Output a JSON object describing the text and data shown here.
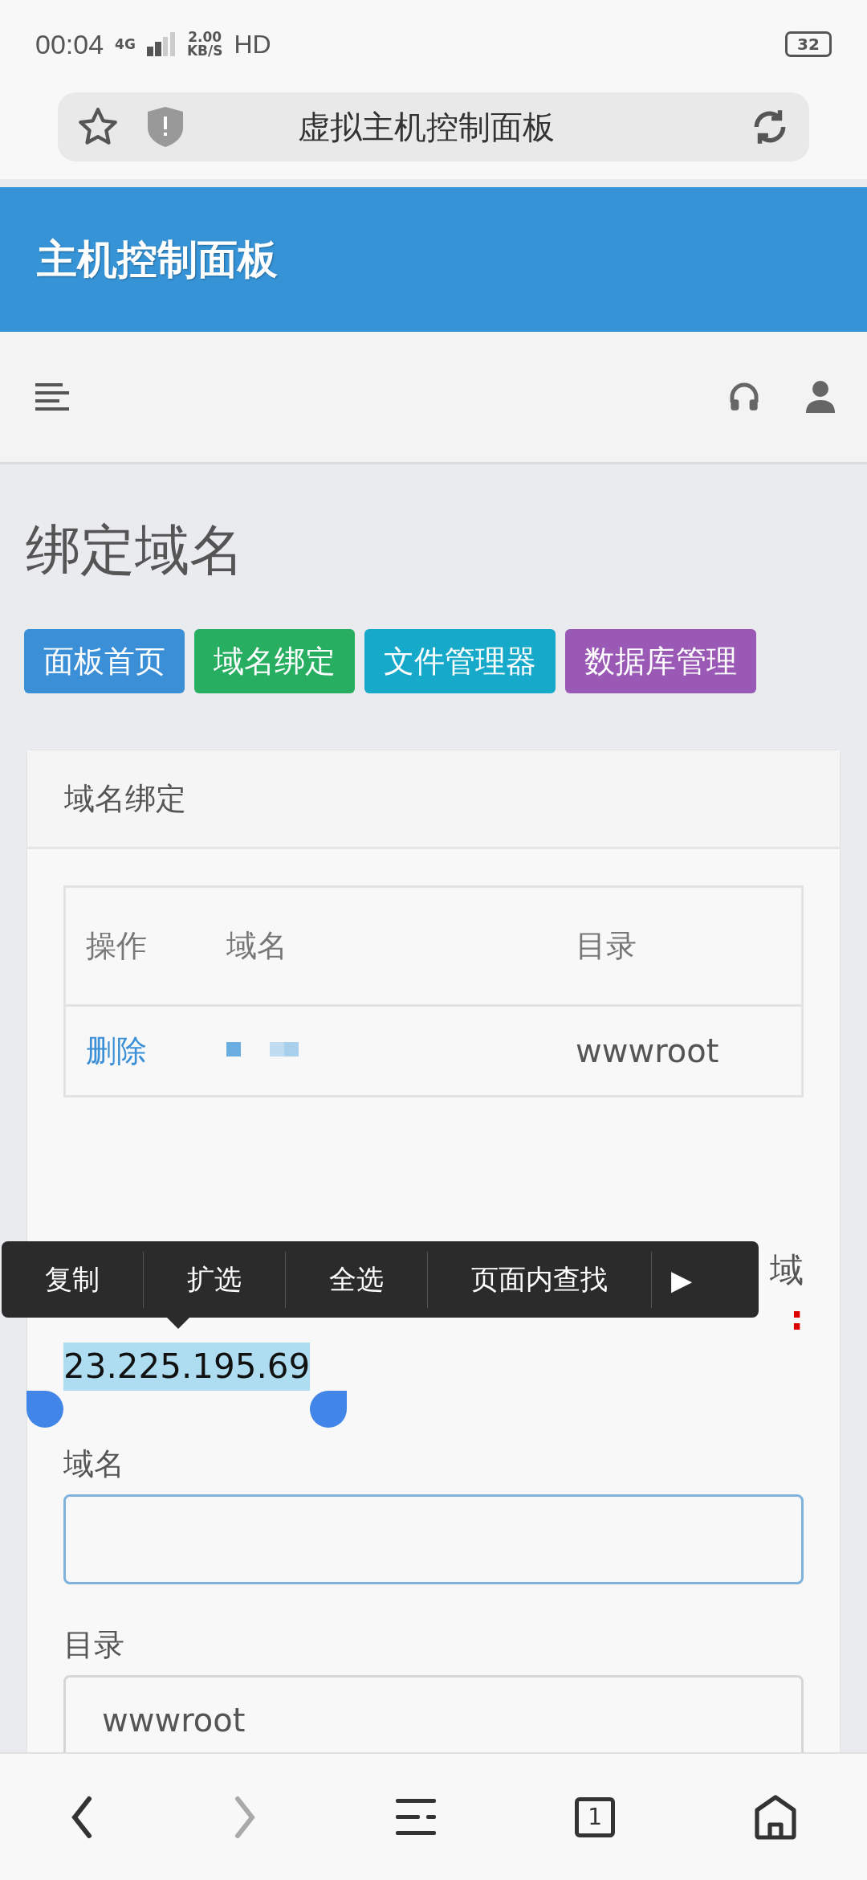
{
  "status_bar": {
    "time": "00:04",
    "network": "4G",
    "speed_value": "2.00",
    "speed_unit": "KB/S",
    "hd": "HD",
    "battery": "32"
  },
  "browser_bar": {
    "title": "虚拟主机控制面板"
  },
  "header": {
    "title": "主机控制面板"
  },
  "page": {
    "title": "绑定域名"
  },
  "buttons": [
    {
      "label": "面板首页",
      "color": "#3a8fd6"
    },
    {
      "label": "域名绑定",
      "color": "#27ae60"
    },
    {
      "label": "文件管理器",
      "color": "#17a9c9"
    },
    {
      "label": "数据库管理",
      "color": "#9b59b6"
    }
  ],
  "card": {
    "title": "域名绑定",
    "table": {
      "columns": [
        "操作",
        "域名",
        "目录"
      ],
      "rows": [
        {
          "action": "删除",
          "directory": "wwwroot"
        }
      ]
    },
    "notice": {
      "line_end": "域",
      "red_fragment": ":",
      "selected_text": "23.225.195.69"
    },
    "fields": [
      {
        "label": "域名",
        "focused": true
      },
      {
        "label": "目录",
        "value": "wwwroot",
        "focused": false
      }
    ]
  },
  "context_menu": {
    "items": [
      "复制",
      "扩选",
      "全选",
      "页面内查找",
      "▶"
    ]
  },
  "bottom_nav": {
    "tabs": "1"
  }
}
